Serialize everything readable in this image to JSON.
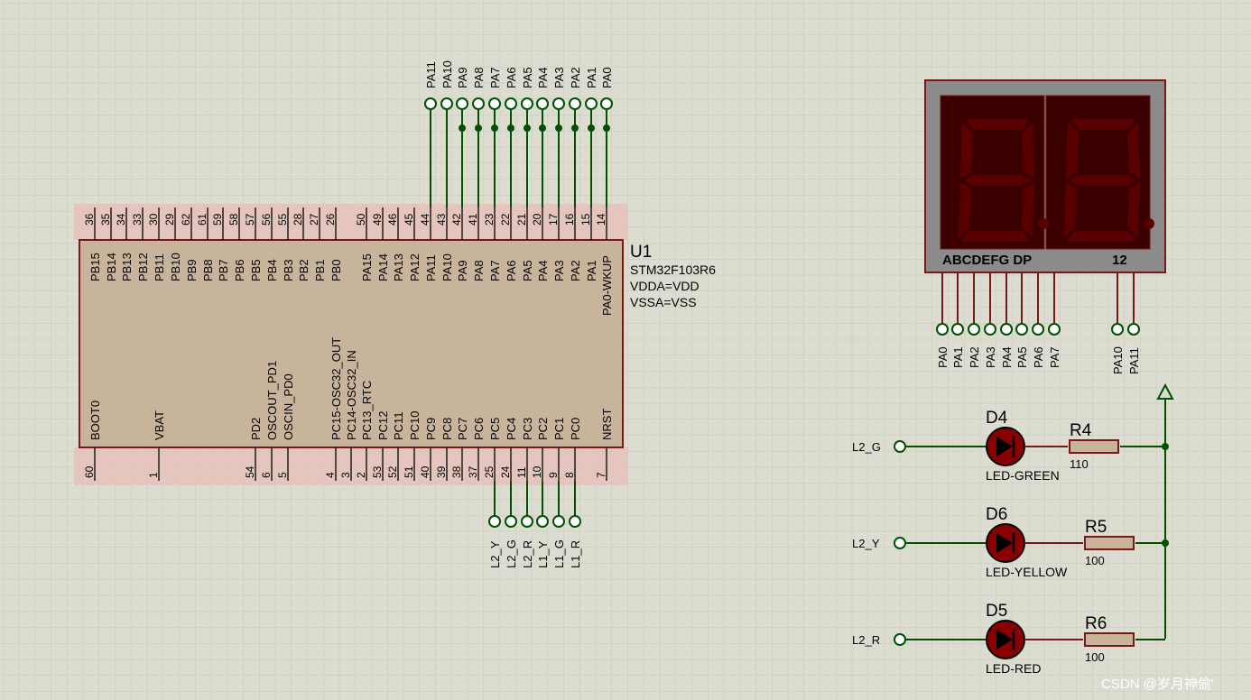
{
  "mcu": {
    "ref": "U1",
    "part": "STM32F103R6",
    "props": [
      "VDDA=VDD",
      "VSSA=VSS"
    ],
    "top_pins": [
      {
        "name": "PB15",
        "num": "36"
      },
      {
        "name": "PB14",
        "num": "35"
      },
      {
        "name": "PB13",
        "num": "34"
      },
      {
        "name": "PB12",
        "num": "33"
      },
      {
        "name": "PB11",
        "num": "30"
      },
      {
        "name": "PB10",
        "num": "29"
      },
      {
        "name": "PB9",
        "num": "62"
      },
      {
        "name": "PB8",
        "num": "61"
      },
      {
        "name": "PB7",
        "num": "59"
      },
      {
        "name": "PB6",
        "num": "58"
      },
      {
        "name": "PB5",
        "num": "57"
      },
      {
        "name": "PB4",
        "num": "56"
      },
      {
        "name": "PB3",
        "num": "55"
      },
      {
        "name": "PB2",
        "num": "28"
      },
      {
        "name": "PB1",
        "num": "27"
      },
      {
        "name": "PB0",
        "num": "26"
      },
      {
        "name": "PA15",
        "num": "50"
      },
      {
        "name": "PA14",
        "num": "49"
      },
      {
        "name": "PA13",
        "num": "46"
      },
      {
        "name": "PA12",
        "num": "45"
      },
      {
        "name": "PA11",
        "num": "44"
      },
      {
        "name": "PA10",
        "num": "43"
      },
      {
        "name": "PA9",
        "num": "42"
      },
      {
        "name": "PA8",
        "num": "41"
      },
      {
        "name": "PA7",
        "num": "23"
      },
      {
        "name": "PA6",
        "num": "22"
      },
      {
        "name": "PA5",
        "num": "21"
      },
      {
        "name": "PA4",
        "num": "20"
      },
      {
        "name": "PA3",
        "num": "17"
      },
      {
        "name": "PA2",
        "num": "16"
      },
      {
        "name": "PA1",
        "num": "15"
      },
      {
        "name": "PA0-WKUP",
        "num": "14"
      }
    ],
    "bottom_pins": [
      {
        "name": "BOOT0",
        "num": "60"
      },
      {
        "name": "VBAT",
        "num": "1"
      },
      {
        "name": "PD2",
        "num": "54"
      },
      {
        "name": "OSCOUT_PD1",
        "num": "6"
      },
      {
        "name": "OSCIN_PD0",
        "num": "5"
      },
      {
        "name": "PC15-OSC32_OUT",
        "num": "4"
      },
      {
        "name": "PC14-OSC32_IN",
        "num": "3"
      },
      {
        "name": "PC13_RTC",
        "num": "2"
      },
      {
        "name": "PC12",
        "num": "53"
      },
      {
        "name": "PC11",
        "num": "52"
      },
      {
        "name": "PC10",
        "num": "51"
      },
      {
        "name": "PC9",
        "num": "40"
      },
      {
        "name": "PC8",
        "num": "39"
      },
      {
        "name": "PC7",
        "num": "38"
      },
      {
        "name": "PC6",
        "num": "37"
      },
      {
        "name": "PC5",
        "num": "25"
      },
      {
        "name": "PC4",
        "num": "24"
      },
      {
        "name": "PC3",
        "num": "11"
      },
      {
        "name": "PC2",
        "num": "10"
      },
      {
        "name": "PC1",
        "num": "9"
      },
      {
        "name": "PC0",
        "num": "8"
      },
      {
        "name": "NRST",
        "num": "7"
      }
    ]
  },
  "top_net_labels": [
    "PA11",
    "PA10",
    "PA9",
    "PA8",
    "PA7",
    "PA6",
    "PA5",
    "PA4",
    "PA3",
    "PA2",
    "PA1",
    "PA0"
  ],
  "bottom_net_labels": [
    "L2_Y",
    "L2_G",
    "L2_R",
    "L1_Y",
    "L1_G",
    "L1_R"
  ],
  "display": {
    "segment_label": "ABCDEFG DP",
    "digit_label": "12",
    "segment_net_labels": [
      "PA0",
      "PA1",
      "PA2",
      "PA3",
      "PA4",
      "PA5",
      "PA6",
      "PA7"
    ],
    "digit_net_labels": [
      "PA10",
      "PA11"
    ]
  },
  "leds": [
    {
      "terminal": "L2_G",
      "ref": "D4",
      "part": "LED-GREEN",
      "res_ref": "R4",
      "res_val": "110"
    },
    {
      "terminal": "L2_Y",
      "ref": "D6",
      "part": "LED-YELLOW",
      "res_ref": "R5",
      "res_val": "100"
    },
    {
      "terminal": "L2_R",
      "ref": "D5",
      "part": "LED-RED",
      "res_ref": "R6",
      "res_val": "100"
    }
  ],
  "watermark": "CSDN @岁月神偷'",
  "colors": {
    "background": "#dcdcd0",
    "grid": "#c8c8bb",
    "wire": "#005000",
    "body": "#c8b49b",
    "outline": "#7a1818",
    "segment_off": "#5a0000",
    "led_fill": "#8a0000"
  }
}
